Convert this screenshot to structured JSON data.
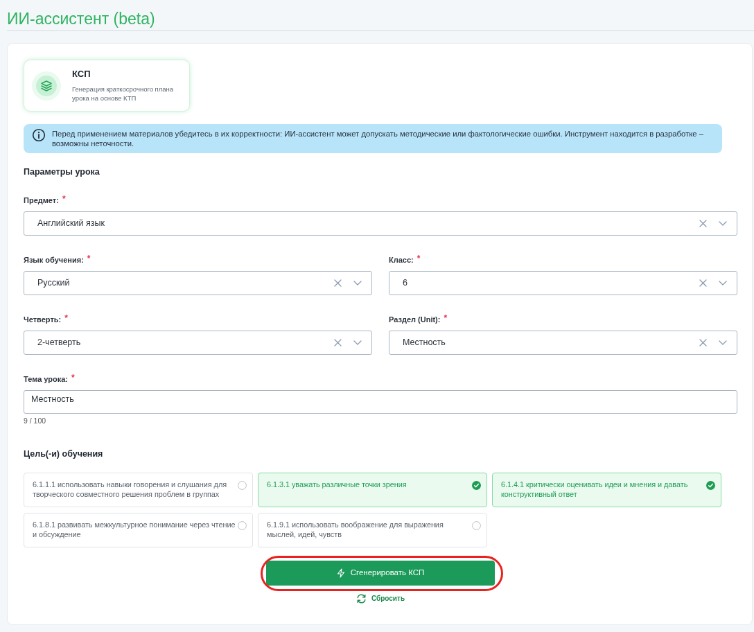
{
  "page": {
    "title": "ИИ-ассистент (beta)"
  },
  "tools": [
    {
      "title": "КСП",
      "description": "Генерация краткосрочного плана урока на основе КТП",
      "selected": true
    }
  ],
  "notice": {
    "text": "Перед применением материалов убедитесь в их корректности: ИИ-ассистент может допускать методические или фактологические ошибки. Инструмент находится в разработке – возможны неточности."
  },
  "params": {
    "heading": "Параметры урока",
    "rows": [
      {
        "fields": [
          {
            "kind": "select",
            "label": "Предмет:",
            "required_mark": "*",
            "value": "Английский язык"
          }
        ]
      },
      {
        "fields": [
          {
            "kind": "select",
            "label": "Язык обучения:",
            "required_mark": "*",
            "value": "Русский"
          },
          {
            "kind": "select",
            "label": "Класс:",
            "required_mark": "*",
            "value": "6"
          }
        ]
      },
      {
        "fields": [
          {
            "kind": "select",
            "label": "Четверть:",
            "required_mark": "*",
            "value": "2-четверть"
          },
          {
            "kind": "select",
            "label": "Раздел (Unit):",
            "required_mark": "*",
            "value": "Местность"
          }
        ]
      },
      {
        "fields": [
          {
            "kind": "textarea",
            "label": "Тема урока:",
            "required_mark": "*",
            "value": "Местность",
            "counter": "9 / 100"
          }
        ]
      }
    ]
  },
  "goals": {
    "heading": "Цель(-и) обучения",
    "items": [
      {
        "text": "6.1.1.1 использовать навыки говорения и слушания для творческого совместного решения проблем в группах",
        "selected": false
      },
      {
        "text": "6.1.3.1 уважать различные точки зрения",
        "selected": true
      },
      {
        "text": "6.1.4.1 критически оценивать идеи и мнения и давать конструктивный ответ",
        "selected": true
      },
      {
        "text": "6.1.8.1 развивать межкультурное понимание через чтение и обсуждение",
        "selected": false
      },
      {
        "text": "6.1.9.1 использовать воображение для выражения мыслей, идей, чувств",
        "selected": false
      }
    ]
  },
  "actions": {
    "generate": {
      "label": "Сгенерировать КСП",
      "highlighted": true
    },
    "reset": {
      "label": "Сбросить"
    }
  }
}
